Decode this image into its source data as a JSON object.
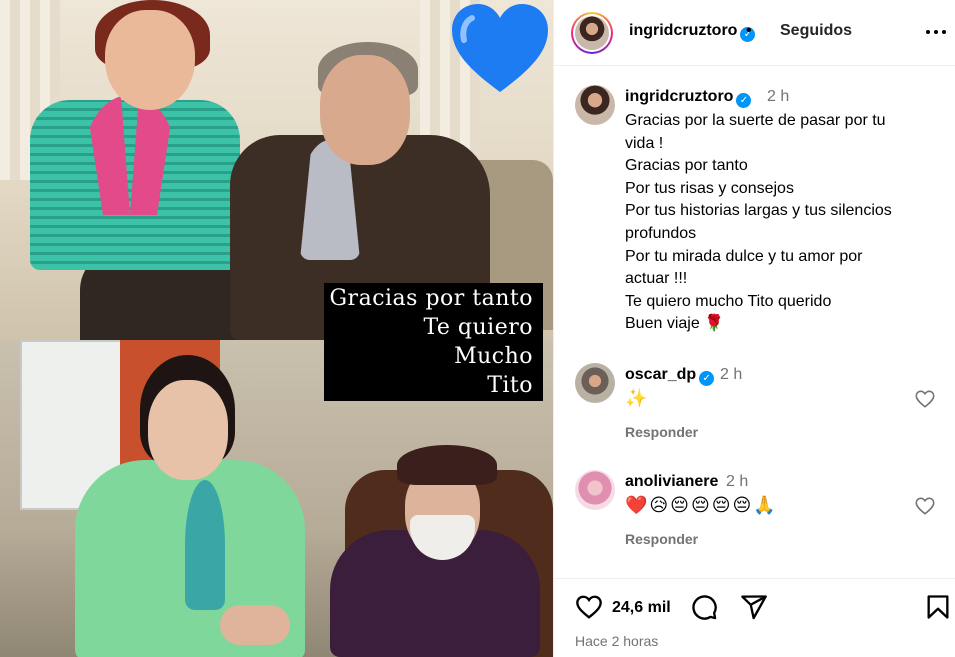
{
  "post": {
    "image_caption": [
      "Gracias por tanto",
      "Te quiero",
      "Mucho",
      "Tito"
    ]
  },
  "header": {
    "username": "ingridcruztoro",
    "separator": "•",
    "follow_status": "Seguidos"
  },
  "caption": {
    "username": "ingridcruztoro",
    "time": "2 h",
    "lines": [
      "Gracias por la suerte de pasar por tu",
      "vida !",
      "Gracias por tanto",
      "Por tus risas y consejos",
      "Por tus historias largas y tus silencios",
      "profundos",
      "Por tu mirada dulce y tu amor por",
      "actuar !!!",
      "Te quiero mucho Tito querido",
      "Buen viaje 🌹"
    ]
  },
  "comments": [
    {
      "username": "oscar_dp",
      "verified": true,
      "time": "2 h",
      "text": "✨",
      "reply_label": "Responder"
    },
    {
      "username": "anolivianere",
      "verified": false,
      "time": "2 h",
      "text": "❤️😥😔😔😔😔🙏",
      "reply_label": "Responder"
    }
  ],
  "actions": {
    "likes": "24,6 mil",
    "posted": "Hace 2 horas"
  },
  "colors": {
    "verified_blue": "#0095f6",
    "secondary_text": "#737373",
    "heart_emoji": "#1e7cf2"
  },
  "icons": [
    "blue-heart-emoji-icon",
    "verified-badge-icon",
    "more-options-icon",
    "like-heart-icon",
    "comment-icon",
    "share-icon",
    "save-bookmark-icon"
  ]
}
